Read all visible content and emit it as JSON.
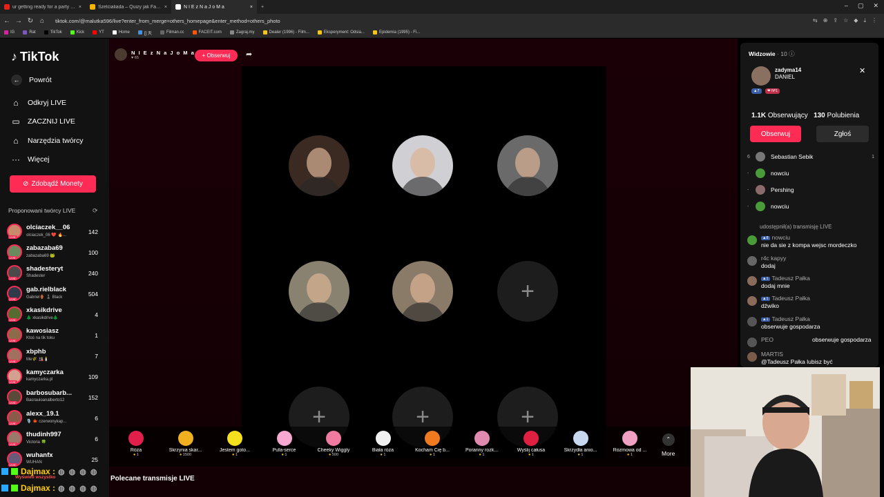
{
  "tabs": [
    {
      "title": "ur getting ready for a party D pu",
      "color": "#e62117"
    },
    {
      "title": "Szelcialiada – Quizy jak Familiada! G",
      "color": "#f5b400"
    },
    {
      "title": "N I E z N a J o M a",
      "color": "#ffffff",
      "active": true
    },
    {
      "title": "+",
      "color": "#1f1f1f"
    }
  ],
  "window_controls": [
    "–",
    "▢",
    "✕"
  ],
  "url": "tiktok.com/@malutka596/live?enter_from_merge=others_homepage&enter_method=others_photo",
  "bookmarks": [
    {
      "label": "IG",
      "color": "#d6249f"
    },
    {
      "label": "Rat",
      "color": "#7e57c2"
    },
    {
      "label": "TikTok",
      "color": "#000000"
    },
    {
      "label": "Kick",
      "color": "#53fc18"
    },
    {
      "label": "YT",
      "color": "#ff0000"
    },
    {
      "label": "Home",
      "color": "#ffffff"
    },
    {
      "label": "[] 天",
      "color": "#4a90d9"
    },
    {
      "label": "Filman.cc",
      "color": "#666666"
    },
    {
      "label": "FACEIT.com",
      "color": "#ff5500"
    },
    {
      "label": "Zagraj.my",
      "color": "#888888"
    },
    {
      "label": "Dealer (1996) - Film...",
      "color": "#f5c518"
    },
    {
      "label": "Eksperyment: Odsia...",
      "color": "#f5c518"
    },
    {
      "label": "Epidemia (1995) - Fi...",
      "color": "#f5c518"
    }
  ],
  "sidebar": {
    "logo": "TikTok",
    "back": "Powrót",
    "nav": [
      {
        "label": "Odkryj LIVE",
        "icon": "live-icon"
      },
      {
        "label": "ZACZNIJ LIVE",
        "icon": "camera-icon"
      },
      {
        "label": "Narzędzia twórcy",
        "icon": "home-tools-icon"
      },
      {
        "label": "Więcej",
        "icon": "more-icon"
      }
    ],
    "coins_label": "Zdobądź Monety",
    "suggested_title": "Proponowani twórcy LIVE",
    "creators": [
      {
        "name": "olciaczek__06",
        "sub": "olciaczek_06 ❤️ 🔥...",
        "count": "142",
        "color": "#c98a6b"
      },
      {
        "name": "zabazaba69",
        "sub": "zabazaba69 🐸",
        "count": "100",
        "color": "#6b8a5e"
      },
      {
        "name": "shadesteryt",
        "sub": "Shadester",
        "count": "240",
        "color": "#4a4a4a"
      },
      {
        "name": "gab.rielblack",
        "sub": "Gabriel🏺 ♟️ Black",
        "count": "504",
        "color": "#2e3a4a"
      },
      {
        "name": "xkasikdrive",
        "sub": "🌲 xkasikdrive🌲",
        "count": "4",
        "color": "#556b2f"
      },
      {
        "name": "kawosiasz",
        "sub": "Ktoś na tik toku",
        "count": "1",
        "color": "#8b6b4a"
      },
      {
        "name": "xbphb",
        "sub": "Me🌾 🎎🕯️",
        "count": "7",
        "color": "#a07060"
      },
      {
        "name": "kamyczarka",
        "sub": "kamyczarka.pl",
        "count": "109",
        "color": "#d4a090"
      },
      {
        "name": "barbosubarb...",
        "sub": "Bacrauioanalberto12",
        "count": "152",
        "color": "#5a4a3a"
      },
      {
        "name": "alexx_19.1",
        "sub": "🎙️ 🍁 czerwonykap...",
        "count": "6",
        "color": "#8a5a4a"
      },
      {
        "name": "thudinh997",
        "sub": "Victoria 🍀",
        "count": "6",
        "color": "#9a7a6a"
      },
      {
        "name": "wuhanfx",
        "sub": "WUHAN",
        "count": "25",
        "color": "#6a5a7a"
      }
    ]
  },
  "stream": {
    "host_name": "N I E z N a J o M a",
    "host_likes": "♥ 65",
    "follow_label": "+ Obserwuj",
    "seats": [
      {
        "type": "user",
        "color": "#3a2a22"
      },
      {
        "type": "user",
        "color": "#cfcfd4"
      },
      {
        "type": "user",
        "color": "#6a6a6a"
      },
      {
        "type": "user",
        "color": "#8a8270"
      },
      {
        "type": "user",
        "color": "#8a7a68"
      },
      {
        "type": "add",
        "icon": "plus-icon"
      },
      {
        "type": "add",
        "icon": "plus-icon"
      },
      {
        "type": "add",
        "icon": "plus-icon"
      },
      {
        "type": "add",
        "icon": "plus-icon"
      }
    ],
    "gifts": [
      {
        "name": "Róża",
        "price": "1",
        "color": "#e0204a"
      },
      {
        "name": "Skrzynia skar...",
        "price": "1500",
        "color": "#f0b020"
      },
      {
        "name": "Jestem goto...",
        "price": "1",
        "color": "#f5e020"
      },
      {
        "name": "Pufa-serce",
        "price": "1",
        "color": "#f7a8d0"
      },
      {
        "name": "Cheeky Wiggly",
        "price": "500",
        "color": "#f07aa0"
      },
      {
        "name": "Biała róża",
        "price": "1",
        "color": "#f0f0f0"
      },
      {
        "name": "Kocham Cię b...",
        "price": "1",
        "color": "#f07a20"
      },
      {
        "name": "Poranny rozk...",
        "price": "1",
        "color": "#e08ab0"
      },
      {
        "name": "Wyślij całusa",
        "price": "1",
        "color": "#e02040"
      },
      {
        "name": "Skrzydła anio...",
        "price": "1",
        "color": "#c8d8f0"
      },
      {
        "name": "Rozmowa od ...",
        "price": "1",
        "color": "#f0a0c0"
      }
    ],
    "more_label": "More",
    "recommended_title": "Polecane transmisje LIVE"
  },
  "panel": {
    "viewers_label": "Widzowie",
    "viewers_count": "· 10",
    "profile": {
      "username": "zadyma14",
      "display_name": "DANIEL",
      "badges": [
        {
          "text": "▲7",
          "color": "#3a5ea8"
        },
        {
          "text": "❤ Nº1",
          "color": "#c0304a"
        }
      ],
      "followers": "1.1K",
      "followers_label": "Obserwujący",
      "likes": "130",
      "likes_label": "Polubienia",
      "follow_label": "Obserwuj",
      "report_label": "Zgłoś"
    },
    "viewer_rows": [
      {
        "rank": "6",
        "name": "Sebastian Sebik",
        "value": "1",
        "color": "#777"
      },
      {
        "rank": "-",
        "name": "nowciu",
        "value": "",
        "color": "#4a9a3a"
      },
      {
        "rank": "-",
        "name": "Pershing",
        "value": "",
        "color": "#8a6a6a"
      },
      {
        "rank": "-",
        "name": "nowciu",
        "value": "",
        "color": "#4a9a3a"
      }
    ],
    "share_notice": "udostępnił(a) transmisję LIVE",
    "chat": [
      {
        "name": "nowciu",
        "level": "▲8",
        "text": "nie da sie z kompa wejsc mordeczko",
        "color": "#4a9a3a"
      },
      {
        "name": "r4c kapyy",
        "level": "",
        "text": "dodaj",
        "color": "#666"
      },
      {
        "name": "Tadeusz Pałka",
        "level": "▲1",
        "text": "dodaj mnie",
        "color": "#8a6a5a"
      },
      {
        "name": "Tadeusz Pałka",
        "level": "▲1",
        "text": "dźwiko",
        "color": "#8a6a5a"
      },
      {
        "name": "Tadeusz Pałka",
        "level": "▲1",
        "text": "obserwuje gospodarza",
        "color": "#555"
      },
      {
        "name": "PEO",
        "level": "",
        "text": "obserwuje gospodarza",
        "color": "#555"
      },
      {
        "name": "MARTIS",
        "level": "",
        "text": "@Tadeusz Pałka lubisz być",
        "color": "#7a5a4a"
      }
    ]
  },
  "kick_overlay": {
    "user1": "Dajmax :",
    "sub": "Wyświetl wszystko",
    "user2": "Dajmax :"
  }
}
